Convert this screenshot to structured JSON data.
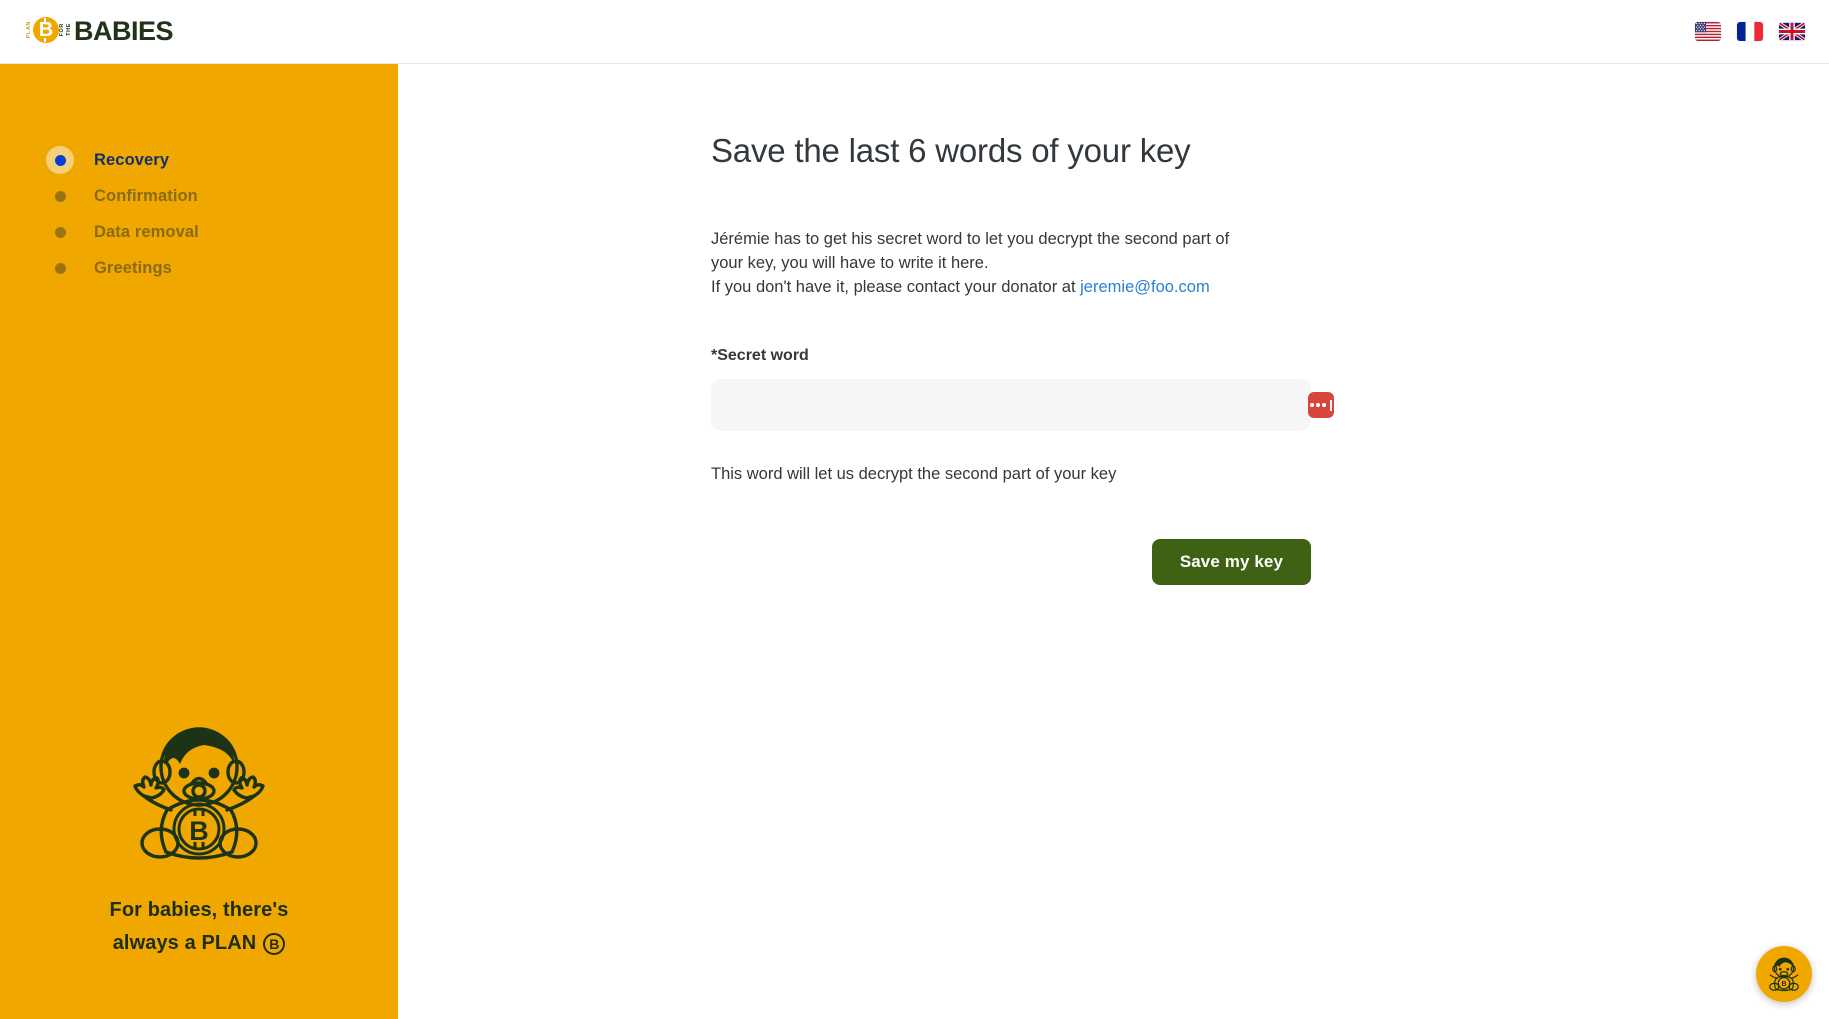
{
  "header": {
    "logo": {
      "vertical_top": "PLAN",
      "vertical_mid": "FOR",
      "vertical_end": "THE",
      "coin_letter": "B",
      "wordmark": "BABIES"
    },
    "languages": [
      {
        "name": "english-us-flag",
        "label": "United States"
      },
      {
        "name": "french-flag",
        "label": "France"
      },
      {
        "name": "english-uk-flag",
        "label": "United Kingdom"
      }
    ]
  },
  "sidebar": {
    "items": [
      {
        "label": "Recovery",
        "active": true
      },
      {
        "label": "Confirmation",
        "active": false
      },
      {
        "label": "Data removal",
        "active": false
      },
      {
        "label": "Greetings",
        "active": false
      }
    ],
    "tagline_line1": "For babies, there's",
    "tagline_line2": "always a PLAN",
    "tagline_badge": "B",
    "background_color": "#f0a800"
  },
  "main": {
    "title": "Save the last 6 words of your key",
    "intro_line1": "Jérémie has to get his secret word to let you decrypt the second part of",
    "intro_line2": "your key, you will have to write it here.",
    "intro_line3": "If you don't have it, please contact your donator at ",
    "donator_email": "jeremie@foo.com",
    "field_label": "*Secret word",
    "field_value": "",
    "field_placeholder": "",
    "helper_text": "This word will let us decrypt the second part of your key",
    "submit_label": "Save my key",
    "submit_color": "#3e6113",
    "link_color": "#2b7fd4"
  },
  "chat": {
    "name": "support-chat-button"
  }
}
